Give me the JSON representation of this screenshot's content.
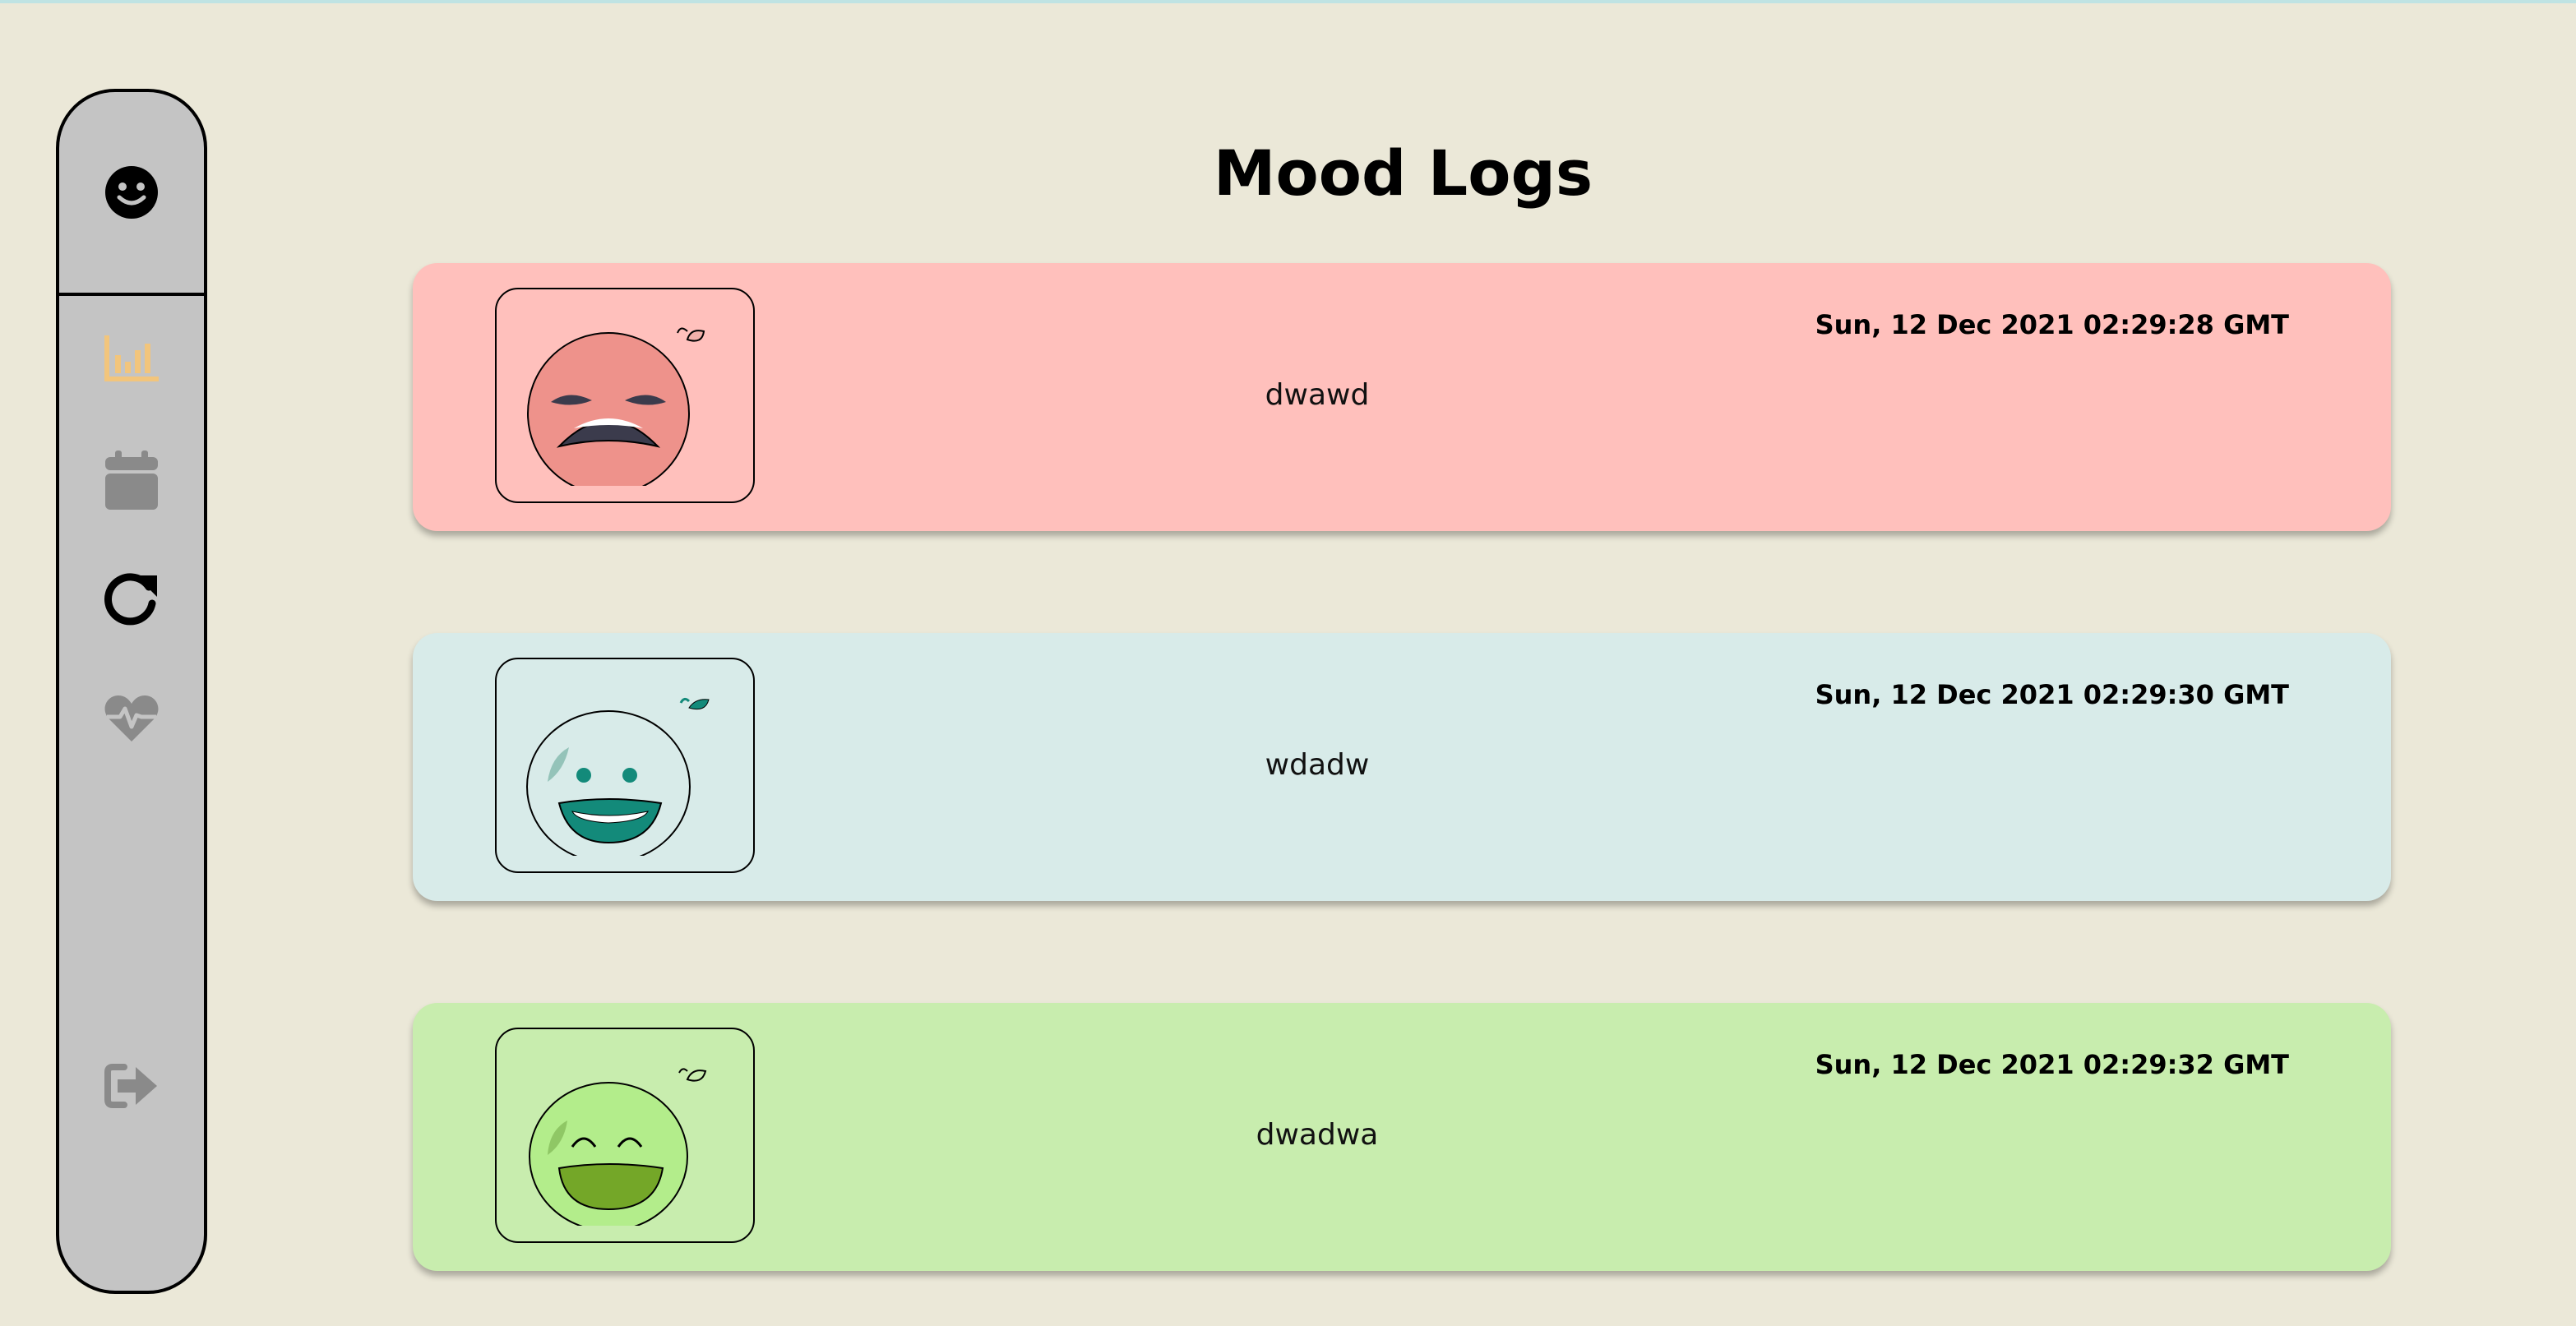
{
  "page": {
    "title": "Mood Logs"
  },
  "sidebar": {
    "items": [
      {
        "name": "mood-smiley-icon",
        "active": true
      },
      {
        "name": "analytics-chart-icon",
        "color": "#f2c57c"
      },
      {
        "name": "calendar-icon",
        "color": "#8a8a8a"
      },
      {
        "name": "refresh-icon",
        "color": "#000000"
      },
      {
        "name": "heart-pulse-icon",
        "color": "#8a8a8a"
      },
      {
        "name": "logout-icon",
        "color": "#8a8a8a"
      }
    ]
  },
  "logs": [
    {
      "note": "dwawd",
      "date": "Sun, 12 Dec 2021 02:29:28 GMT",
      "mood": "angry",
      "bg": "#ffc0bc"
    },
    {
      "note": "wdadw",
      "date": "Sun, 12 Dec 2021 02:29:30 GMT",
      "mood": "happy",
      "bg": "#d8ebe9"
    },
    {
      "note": "dwadwa",
      "date": "Sun, 12 Dec 2021 02:29:32 GMT",
      "mood": "joyful",
      "bg": "#c8edae"
    }
  ],
  "colors": {
    "background": "#ebe8d8",
    "sidebar": "#c4c4c4"
  }
}
